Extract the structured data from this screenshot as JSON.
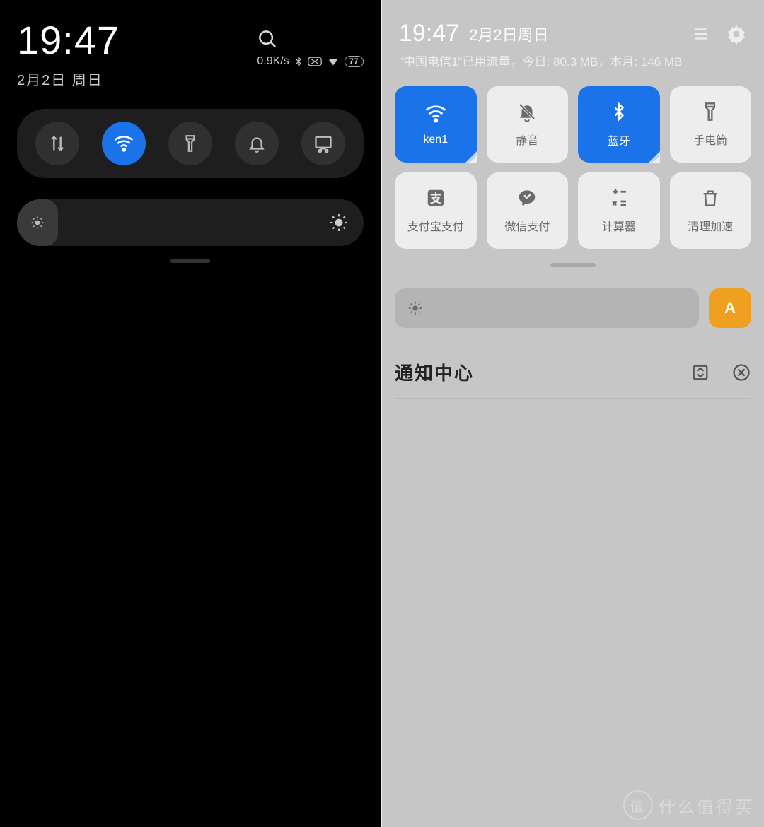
{
  "left": {
    "time": "19:47",
    "date": "2月2日 周日",
    "net_speed": "0.9K/s",
    "battery": "77",
    "toggles": [
      {
        "name": "data-icon",
        "active": false
      },
      {
        "name": "wifi-icon",
        "active": true
      },
      {
        "name": "flashlight-icon",
        "active": false
      },
      {
        "name": "bell-icon",
        "active": false
      },
      {
        "name": "screenshot-icon",
        "active": false
      }
    ],
    "brightness_pct": 4
  },
  "right": {
    "time": "19:47",
    "date": "2月2日周日",
    "data_usage": "\"中国电信1\"已用流量，今日: 80.3 MB，本月: 146 MB",
    "tiles": [
      {
        "icon": "wifi-icon",
        "label": "ken1",
        "active": true
      },
      {
        "icon": "mute-icon",
        "label": "静音",
        "active": false
      },
      {
        "icon": "bluetooth-icon",
        "label": "蓝牙",
        "active": true
      },
      {
        "icon": "flashlight-icon",
        "label": "手电筒",
        "active": false
      },
      {
        "icon": "alipay-icon",
        "label": "支付宝支付",
        "active": false
      },
      {
        "icon": "wechat-icon",
        "label": "微信支付",
        "active": false
      },
      {
        "icon": "calculator-icon",
        "label": "计算器",
        "active": false
      },
      {
        "icon": "clean-icon",
        "label": "清理加速",
        "active": false
      }
    ],
    "auto_brightness_label": "A",
    "brightness_pct": 6,
    "notification_title": "通知中心"
  },
  "watermark": "什么值得买",
  "watermark_badge": "值"
}
